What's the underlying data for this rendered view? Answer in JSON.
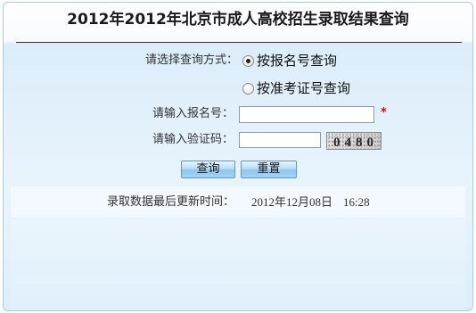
{
  "header": {
    "title": "2012年2012年北京市成人高校招生录取结果查询"
  },
  "form": {
    "query_method": {
      "label": "请选择查询方式：",
      "options": [
        {
          "label": "按报名号查询",
          "selected": true
        },
        {
          "label": "按准考证号查询",
          "selected": false
        }
      ]
    },
    "registration_number": {
      "label": "请输入报名号：",
      "value": "",
      "required_marker": "*"
    },
    "captcha": {
      "label": "请输入验证码：",
      "value": "",
      "image_text": "0480"
    },
    "buttons": {
      "submit_label": "查询",
      "reset_label": "重置"
    }
  },
  "update_info": {
    "label": "录取数据最后更新时间：",
    "date": "2012年12月08日",
    "time": "16:28"
  },
  "colors": {
    "border": "#a8cfea",
    "required": "#e00000",
    "button_border": "#5c97cc"
  }
}
